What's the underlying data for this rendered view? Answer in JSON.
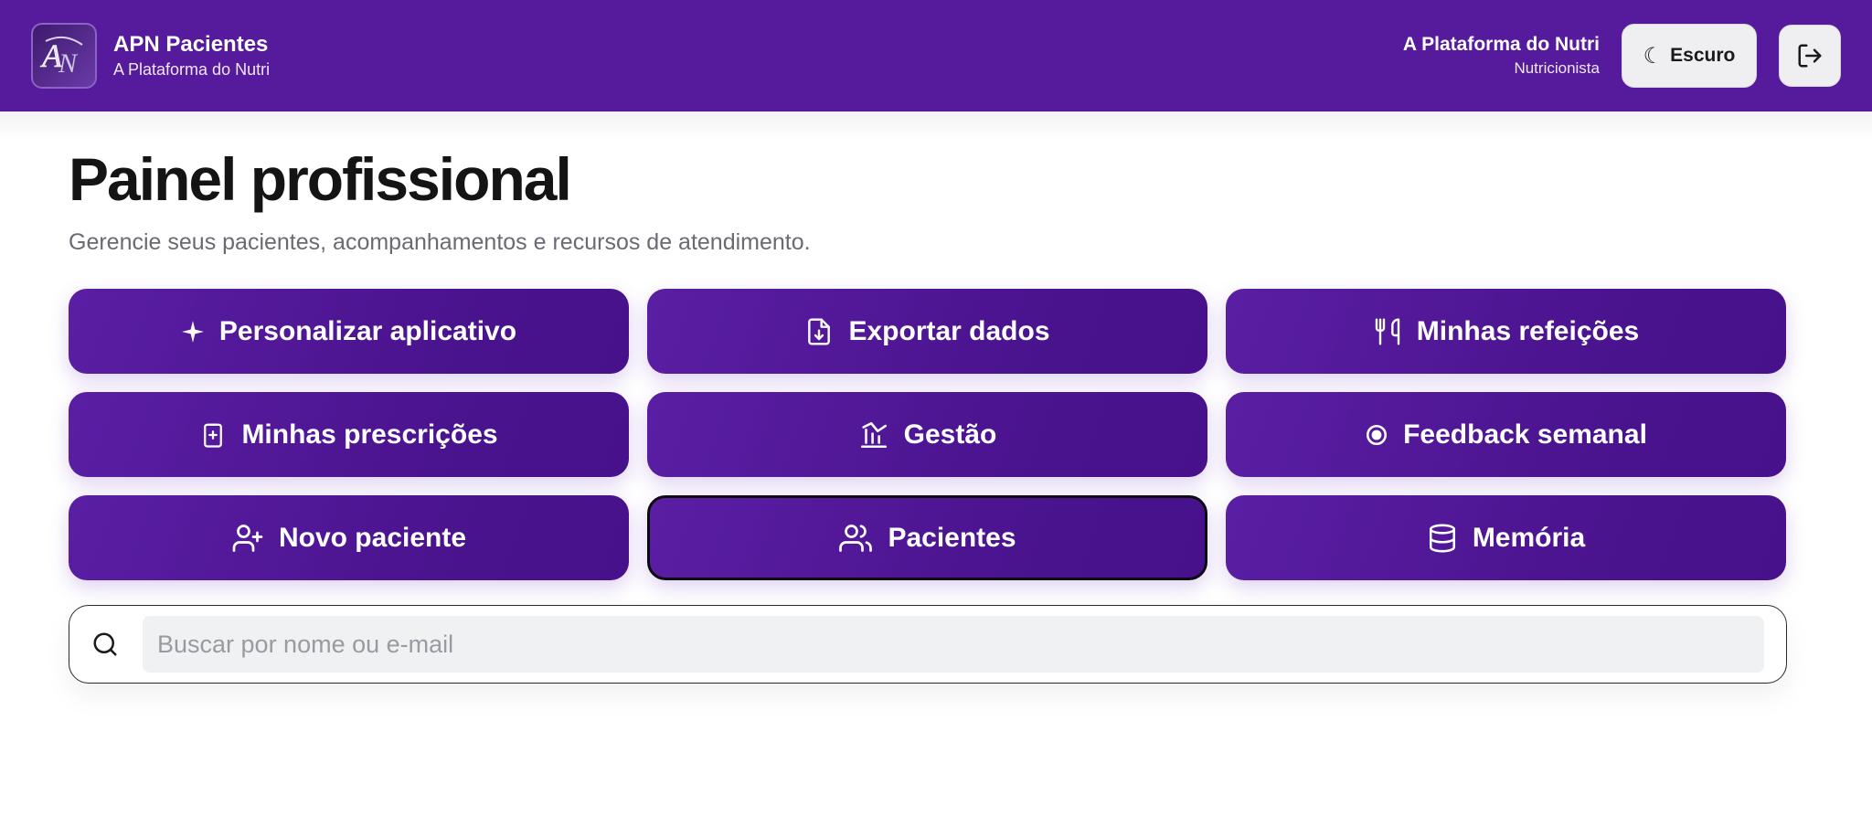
{
  "header": {
    "brand_title": "APN Pacientes",
    "brand_subtitle": "A Plataforma do Nutri",
    "user_name": "A Plataforma do Nutri",
    "user_role": "Nutricionista",
    "theme_label": "Escuro",
    "theme_icon": "moon-icon",
    "logout_icon": "logout-icon",
    "logo_text": "APN",
    "color": "#561a9c"
  },
  "main": {
    "title": "Painel profissional",
    "subtitle": "Gerencie seus pacientes, acompanhamentos e recursos de atendimento."
  },
  "actions": [
    {
      "label": "Personalizar aplicativo",
      "icon": "sparkle-icon"
    },
    {
      "label": "Exportar dados",
      "icon": "file-download-icon"
    },
    {
      "label": "Minhas refeições",
      "icon": "utensils-icon"
    },
    {
      "label": "Minhas prescrições",
      "icon": "clipboard-plus-icon"
    },
    {
      "label": "Gestão",
      "icon": "chart-icon"
    },
    {
      "label": "Feedback semanal",
      "icon": "radio-dot-icon"
    },
    {
      "label": "Novo paciente",
      "icon": "user-plus-icon"
    },
    {
      "label": "Pacientes",
      "icon": "users-icon",
      "selected": true
    },
    {
      "label": "Memória",
      "icon": "database-icon"
    }
  ],
  "search": {
    "placeholder": "Buscar por nome ou e-mail",
    "value": "",
    "icon": "search-icon"
  },
  "colors": {
    "accent": "#561a9c",
    "button": "#4c1490"
  }
}
